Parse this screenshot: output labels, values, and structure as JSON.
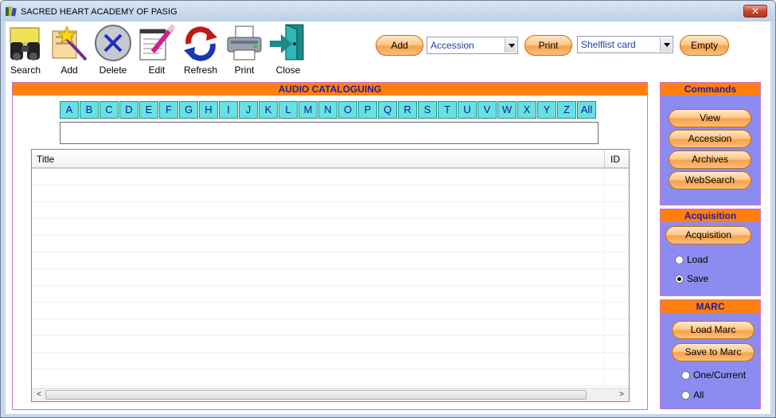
{
  "window": {
    "title": "SACRED HEART ACADEMY OF PASIG",
    "close_label": "✕"
  },
  "toolbar": {
    "buttons": [
      {
        "label": "Search",
        "icon": "binoculars-icon"
      },
      {
        "label": "Add",
        "icon": "magic-wand-folder-icon"
      },
      {
        "label": "Delete",
        "icon": "delete-x-icon"
      },
      {
        "label": "Edit",
        "icon": "edit-notepad-icon"
      },
      {
        "label": "Refresh",
        "icon": "refresh-arrows-icon"
      },
      {
        "label": "Print",
        "icon": "printer-icon"
      },
      {
        "label": "Close",
        "icon": "exit-door-icon"
      }
    ]
  },
  "topbar": {
    "add_label": "Add",
    "add_combo_value": "Accession",
    "print_label": "Print",
    "print_combo_value": "Shelflist card",
    "empty_label": "Empty"
  },
  "main": {
    "header": "AUDIO CATALOGUING",
    "letters": [
      "A",
      "B",
      "C",
      "D",
      "E",
      "F",
      "G",
      "H",
      "I",
      "J",
      "K",
      "L",
      "M",
      "N",
      "O",
      "P",
      "Q",
      "R",
      "S",
      "T",
      "U",
      "V",
      "W",
      "X",
      "Y",
      "Z",
      "All"
    ],
    "search_value": "",
    "columns": {
      "title": "Title",
      "id": "ID"
    },
    "rows": []
  },
  "commands": {
    "header": "Commands",
    "buttons": [
      "View",
      "Accession",
      "Archives",
      "WebSearch"
    ]
  },
  "acquisition": {
    "header": "Acquisition",
    "button": "Acquisition",
    "options": [
      {
        "label": "Load",
        "selected": false
      },
      {
        "label": "Save",
        "selected": true
      }
    ]
  },
  "marc": {
    "header": "MARC",
    "buttons": [
      "Load Marc",
      "Save to Marc"
    ],
    "options": [
      {
        "label": "One/Current",
        "selected": false
      },
      {
        "label": "All",
        "selected": false
      }
    ]
  },
  "colors": {
    "header_orange": "#ff7f0e",
    "header_text": "#1e1ea0",
    "side_panel": "#8c8cf0",
    "letter_cyan": "#66e2e2",
    "pill_orange": "#f7a24c"
  }
}
